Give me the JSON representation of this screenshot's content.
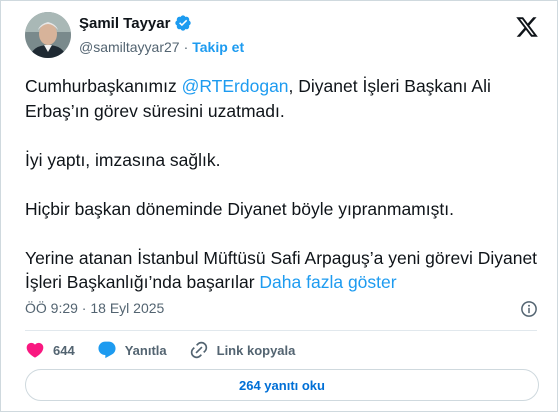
{
  "author": {
    "name": "Şamil Tayyar",
    "handle": "@samiltayyar27",
    "separator": "·",
    "follow_label": "Takip et"
  },
  "tweet": {
    "line1_prefix": "Cumhurbaşkanımız ",
    "mention": "@RTErdogan",
    "line1_suffix": ", Diyanet İşleri Başkanı Ali Erbaş’ın görev süresini uzatmadı.",
    "paragraph2": "İyi yaptı, imzasına sağlık.",
    "paragraph3": "Hiçbir başkan döneminde Diyanet böyle yıpranmamıştı.",
    "paragraph4": "Yerine atanan İstanbul Müftüsü Safi Arpaguş’a yeni görevi Diyanet İşleri Başkanlığı’nda başarılar ",
    "show_more": "Daha fazla göster"
  },
  "meta": {
    "timestamp": "ÖÖ 9:29 · 18 Eyl 2025"
  },
  "actions": {
    "like_count": "644",
    "reply_label": "Yanıtla",
    "copy_link_label": "Link kopyala"
  },
  "read_replies_label": "264 yanıtı oku",
  "colors": {
    "accent": "#1d9bf0",
    "like": "#f91880",
    "muted": "#536471",
    "text": "#0f1419"
  },
  "icons": [
    "verified-badge-icon",
    "x-logo-icon",
    "info-icon",
    "heart-icon",
    "reply-bubble-icon",
    "link-icon"
  ]
}
